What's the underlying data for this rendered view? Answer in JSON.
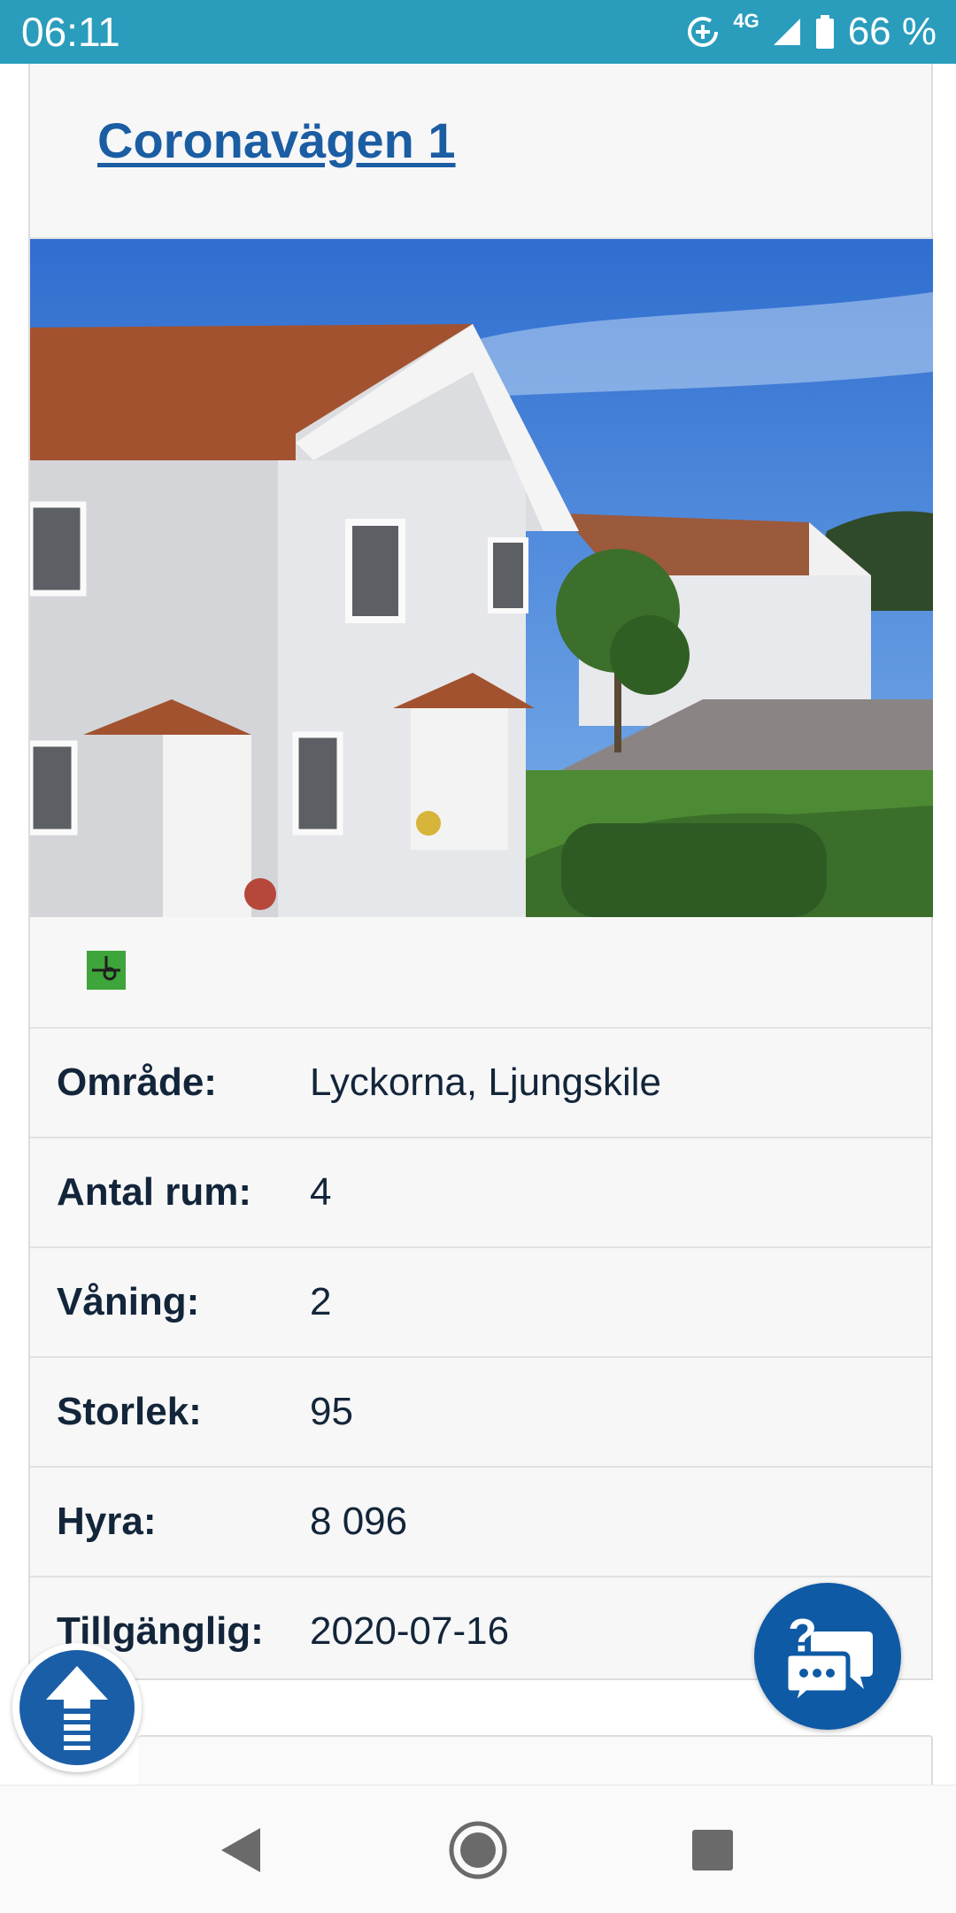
{
  "status_bar": {
    "time": "06:11",
    "network": "4G",
    "battery": "66 %",
    "icons": [
      "data-saver-icon",
      "signal-icon",
      "battery-icon"
    ]
  },
  "listing": {
    "title": "Coronavägen 1",
    "floorplan_icon": "floorplan-icon",
    "details": [
      {
        "label": "Område:",
        "value": "Lyckorna, Ljungskile"
      },
      {
        "label": "Antal rum:",
        "value": "4"
      },
      {
        "label": "Våning:",
        "value": "2"
      },
      {
        "label": "Storlek:",
        "value": "95"
      },
      {
        "label": "Hyra:",
        "value": "8 096"
      },
      {
        "label": "Tillgänglig:",
        "value": "2020-07-16"
      }
    ]
  },
  "floating": {
    "scroll_top_icon": "arrow-up-icon",
    "chat_icon": "chat-help-icon"
  },
  "navigation": {
    "buttons": [
      "back-icon",
      "home-icon",
      "recents-icon"
    ]
  },
  "colors": {
    "status_bar": "#2a9dbd",
    "link": "#1b5da3",
    "fab": "#0e5aa5"
  }
}
